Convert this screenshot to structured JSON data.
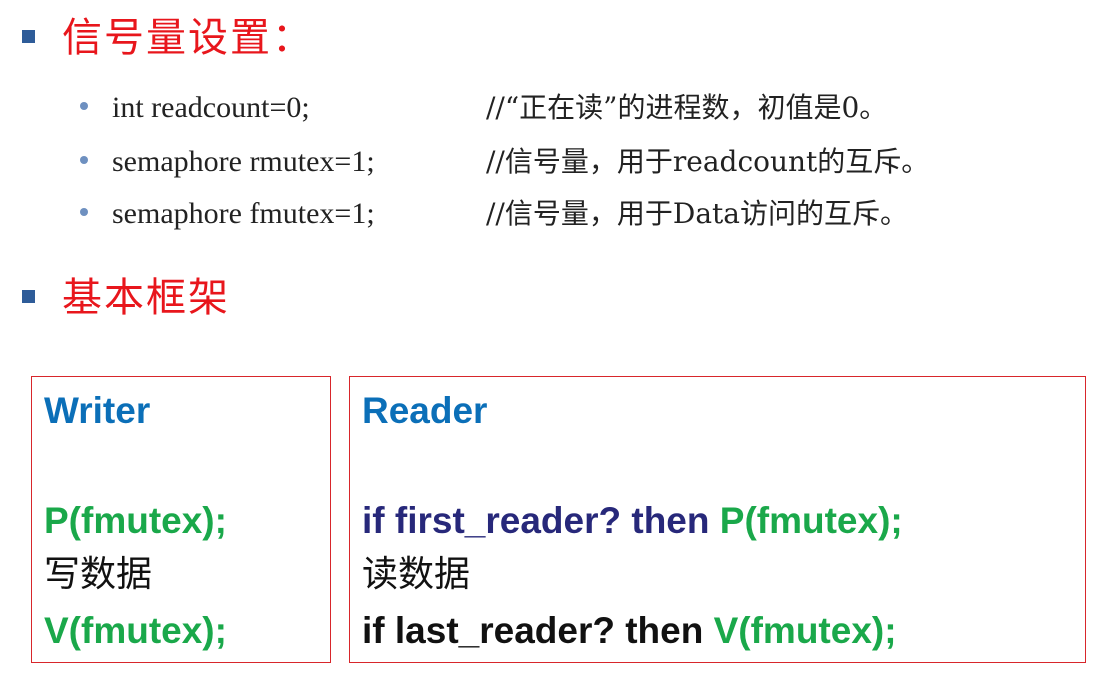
{
  "sections": {
    "semaphore_heading": "信号量设置：",
    "framework_heading": "基本框架"
  },
  "semaphores": [
    {
      "code": "int readcount=0;",
      "comment": "//“正在读”的进程数，初值是0。"
    },
    {
      "code": "semaphore rmutex=1;",
      "comment": "//信号量，用于readcount的互斥。"
    },
    {
      "code": "semaphore fmutex=1;",
      "comment": "//信号量，用于Data访问的互斥。"
    }
  ],
  "writer": {
    "title": "Writer",
    "p_op": "P(fmutex);",
    "action": "写数据",
    "v_op": "V(fmutex);"
  },
  "reader": {
    "title": "Reader",
    "first_cond": "if first_reader? then ",
    "p_op": "P(fmutex);",
    "action": "读数据",
    "last_cond": "if last_reader? then ",
    "v_op": "V(fmutex);"
  },
  "colors": {
    "heading": "#e8161c",
    "title_blue": "#0b6fb8",
    "operation_green": "#1aa84a",
    "condition_navy": "#27287a",
    "box_border": "#d8262b",
    "bullet_square": "#2e5c99"
  }
}
